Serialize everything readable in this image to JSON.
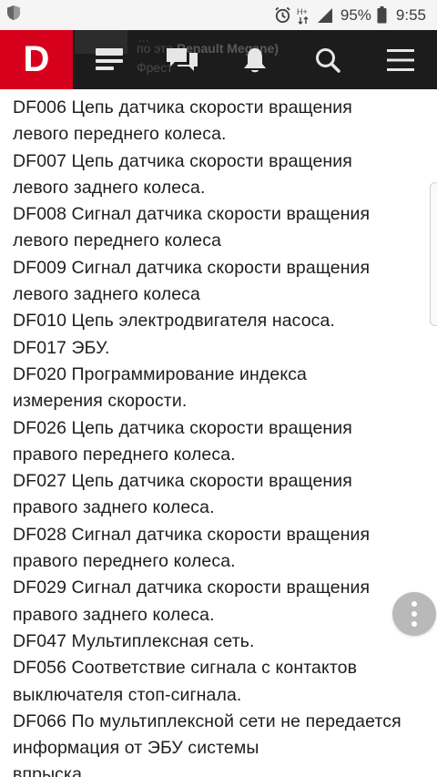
{
  "status_bar": {
    "battery_percent": "95%",
    "time": "9:55",
    "network": "H+",
    "icons": [
      "shield-icon",
      "alarm-icon",
      "network-type-icon",
      "signal-icon",
      "battery-icon"
    ]
  },
  "navbar": {
    "logo": "D",
    "ghost_line_1_prefix": "...",
    "ghost_line_2_prefix": "по это",
    "ghost_line_2_bold": "Renault Megane)",
    "ghost_line_3": "Фрест",
    "icons": [
      "feed-icon",
      "chat-icon",
      "bell-icon",
      "search-icon",
      "menu-icon"
    ],
    "colors": {
      "background": "#1c1c1c",
      "logo_background": "#d6001c"
    }
  },
  "content": {
    "lines": [
      "DF006 Цепь датчика скорости вращения",
      "левого переднего колеса.",
      "DF007 Цепь датчика скорости вращения",
      "левого заднего колеса.",
      "DF008 Сигнал датчика скорости вращения",
      "левого переднего колеса",
      "DF009 Сигнал датчика скорости вращения",
      "левого заднего колеса",
      "DF010 Цепь электродвигателя насоса.",
      "DF017 ЭБУ.",
      "DF020 Программирование индекса",
      "измерения скорости.",
      "DF026 Цепь датчика скорости вращения",
      "правого переднего колеса.",
      "DF027 Цепь датчика скорости вращения",
      "правого заднего колеса.",
      "DF028 Сигнал датчика скорости вращения",
      "правого переднего колеса.",
      "DF029 Сигнал датчика скорости вращения",
      "правого заднего колеса.",
      "DF047 Мультиплексная сеть.",
      "DF056 Соответствие сигнала с контактов",
      "выключателя стоп-сигнала.",
      "DF066 По мультиплексной сети не передается",
      "информация от ЭБУ системы",
      "впрыска."
    ]
  },
  "fab": {
    "icon": "more-vertical-icon"
  }
}
